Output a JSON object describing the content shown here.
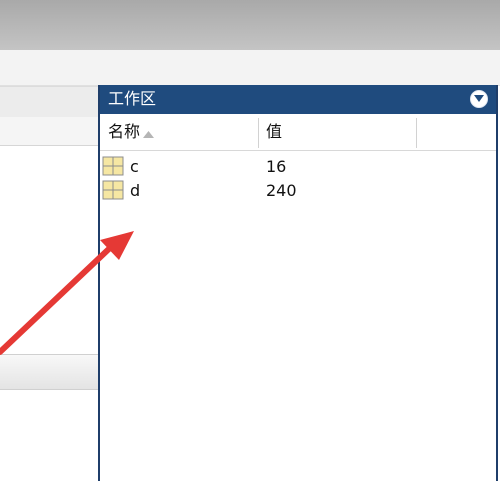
{
  "workspace": {
    "title": "工作区",
    "columns": {
      "name": "名称",
      "value": "值"
    },
    "variables": [
      {
        "name": "c",
        "value": "16"
      },
      {
        "name": "d",
        "value": "240"
      }
    ]
  },
  "colors": {
    "title_bar": "#1f4b7e",
    "annotation_arrow": "#e53935",
    "variable_icon": "#f6e7a3"
  },
  "icons": {
    "menu": "chevron-down-circle-icon",
    "sort": "sort-up-icon",
    "variable": "matrix-variable-icon"
  }
}
